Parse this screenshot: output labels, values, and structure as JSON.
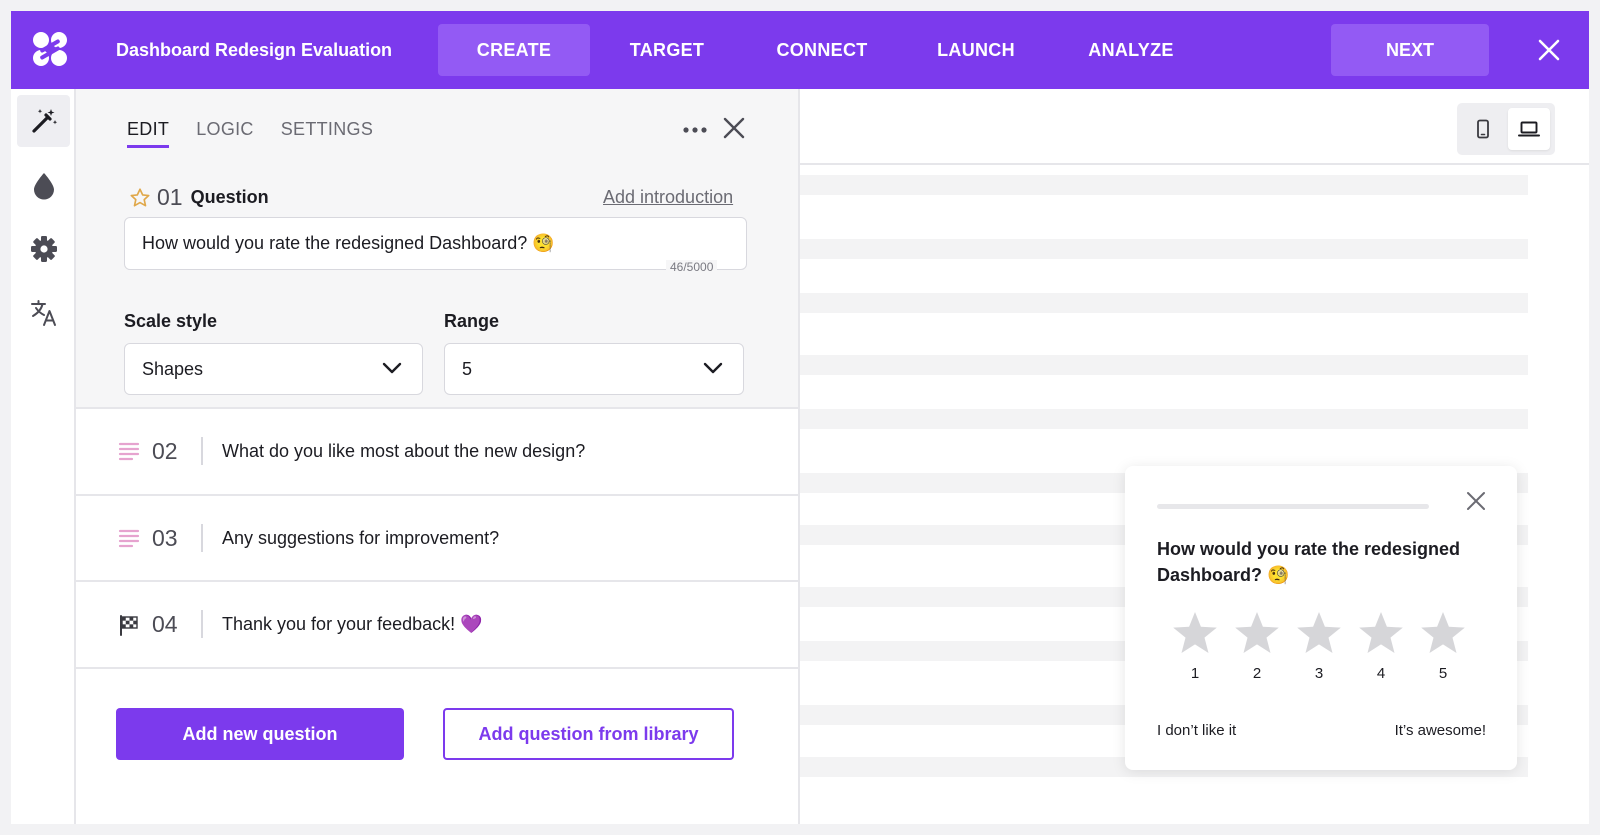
{
  "header": {
    "app_title": "Dashboard Redesign Evaluation",
    "nav": [
      "CREATE",
      "TARGET",
      "CONNECT",
      "LAUNCH",
      "ANALYZE"
    ],
    "active_nav": "CREATE",
    "next_label": "NEXT",
    "colors": {
      "brand": "#7c3aed",
      "brand_light": "#935af4"
    }
  },
  "rail": {
    "icons": [
      "magic-wand-icon",
      "drop-icon",
      "gear-icon",
      "translate-icon"
    ]
  },
  "editor": {
    "tabs": [
      "EDIT",
      "LOGIC",
      "SETTINGS"
    ],
    "active_tab": "EDIT",
    "question": {
      "number": "01",
      "label": "Question",
      "add_intro": "Add introduction",
      "value": "How would you rate the redesigned Dashboard? 🧐",
      "counter": "46/5000"
    },
    "scale_style": {
      "label": "Scale style",
      "value": "Shapes"
    },
    "range": {
      "label": "Range",
      "value": "5"
    },
    "questions": [
      {
        "number": "02",
        "text": "What do you like most about the new design?",
        "icon": "text-lines-icon"
      },
      {
        "number": "03",
        "text": "Any suggestions for improvement?",
        "icon": "text-lines-icon"
      },
      {
        "number": "04",
        "text": "Thank you for your feedback! 💜",
        "icon": "checkered-flag-icon"
      }
    ],
    "add_new_label": "Add new question",
    "add_library_label": "Add question from library"
  },
  "preview": {
    "devices": [
      "mobile-icon",
      "laptop-icon"
    ],
    "active_device": "laptop-icon",
    "widget": {
      "question": "How would you rate the redesigned Dashboard? 🧐",
      "progress": 0,
      "stars": [
        "1",
        "2",
        "3",
        "4",
        "5"
      ],
      "low_label": "I don’t like it",
      "high_label": "It’s awesome!"
    }
  }
}
